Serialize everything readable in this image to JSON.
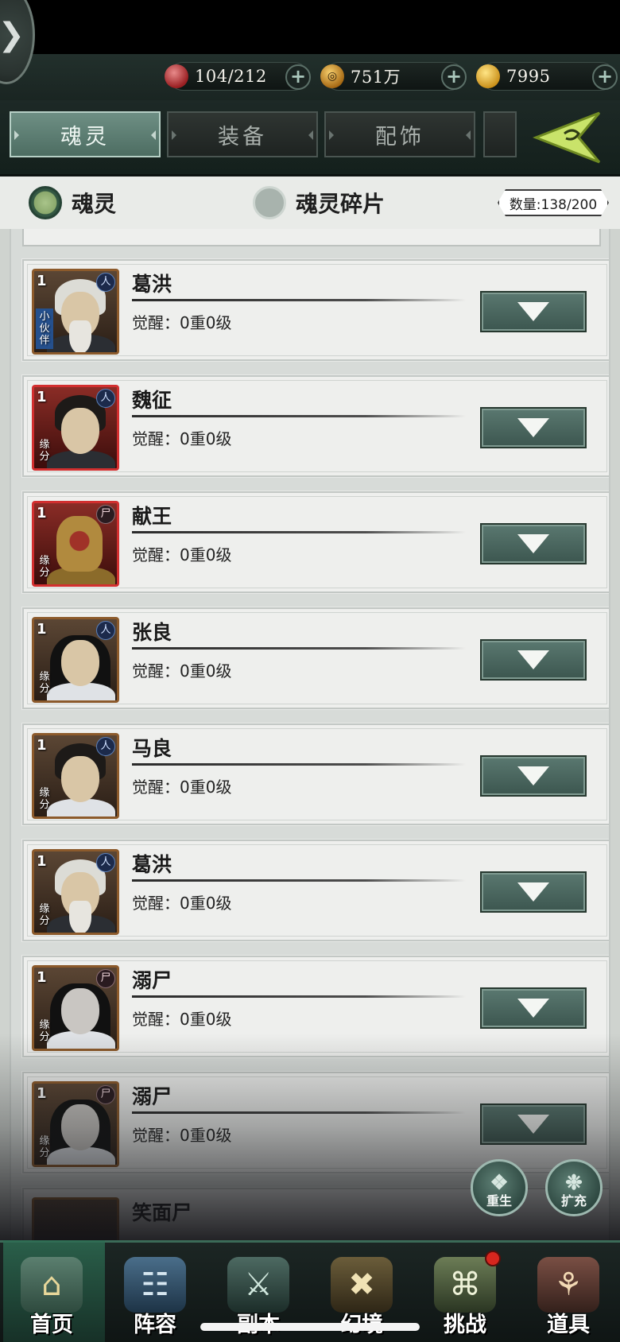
{
  "resources": [
    {
      "icon": "vigor-orb-icon",
      "value": "104/212"
    },
    {
      "icon": "copper-coin-icon",
      "value": "751万"
    },
    {
      "icon": "gold-ingot-icon",
      "value": "7995"
    }
  ],
  "tabs": [
    "魂灵",
    "装备",
    "配饰"
  ],
  "filters": [
    "魂灵",
    "魂灵碎片"
  ],
  "count": "数量:138/200",
  "heroes": [
    {
      "level": "1",
      "name": "葛洪",
      "badge": "人",
      "tag": "小伙伴",
      "awaken": "觉醒：0重0级"
    },
    {
      "level": "1",
      "name": "魏征",
      "badge": "人",
      "tag": "缘分",
      "awaken": "觉醒：0重0级"
    },
    {
      "level": "1",
      "name": "献王",
      "badge": "尸",
      "tag": "缘分",
      "awaken": "觉醒：0重0级"
    },
    {
      "level": "1",
      "name": "张良",
      "badge": "人",
      "tag": "缘分",
      "awaken": "觉醒：0重0级"
    },
    {
      "level": "1",
      "name": "马良",
      "badge": "人",
      "tag": "缘分",
      "awaken": "觉醒：0重0级"
    },
    {
      "level": "1",
      "name": "葛洪",
      "badge": "人",
      "tag": "缘分",
      "awaken": "觉醒：0重0级"
    },
    {
      "level": "1",
      "name": "溺尸",
      "badge": "尸",
      "tag": "缘分",
      "awaken": "觉醒：0重0级"
    },
    {
      "level": "1",
      "name": "溺尸",
      "badge": "尸",
      "tag": "缘分",
      "awaken": "觉醒：0重0级"
    }
  ],
  "partial_hero": {
    "name": "笑面尸"
  },
  "actions": {
    "rebirth": "重生",
    "expand": "扩充"
  },
  "nav": [
    "首页",
    "阵容",
    "副本",
    "幻境",
    "挑战",
    "道具"
  ]
}
